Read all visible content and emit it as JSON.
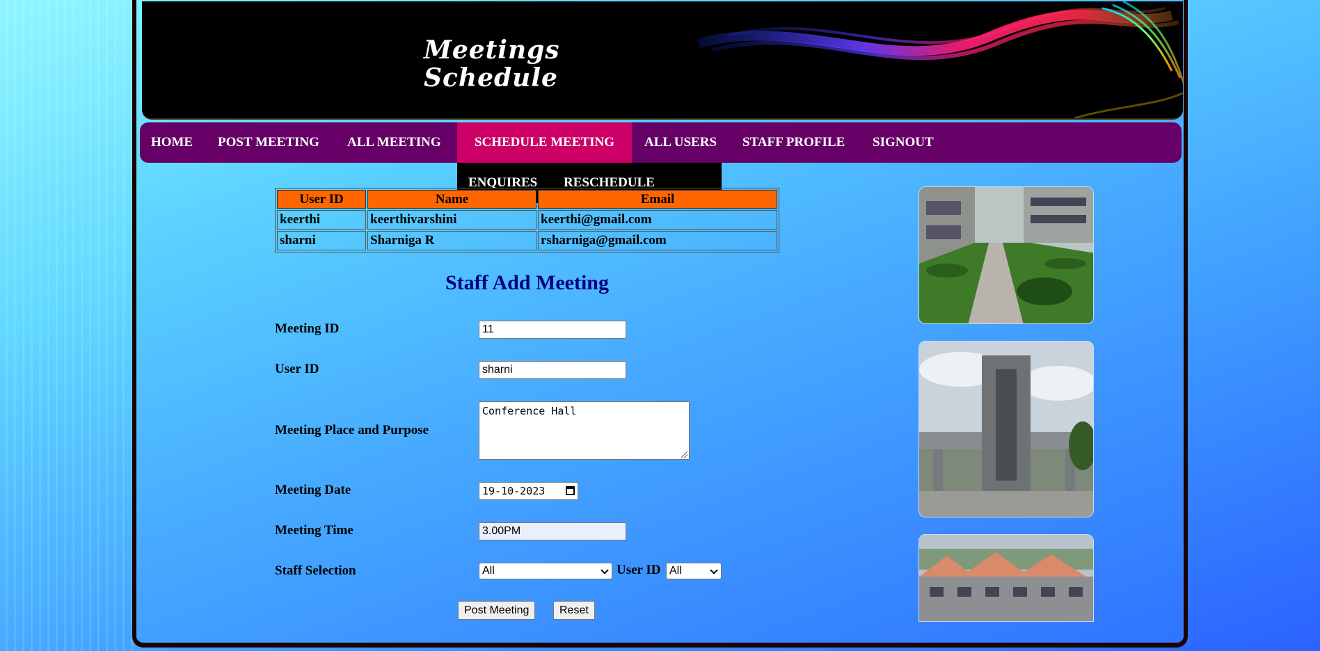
{
  "header": {
    "title_line1": "Meetings",
    "title_line2": "Schedule"
  },
  "nav": {
    "items": [
      "HOME",
      "POST MEETING",
      "ALL MEETING",
      "SCHEDULE MEETING",
      "ALL USERS",
      "STAFF PROFILE",
      "SIGNOUT"
    ],
    "active": "SCHEDULE MEETING",
    "dropdown": [
      "ENQUIRES",
      "RESCHEDULE"
    ]
  },
  "users_table": {
    "headers": [
      "User ID",
      "Name",
      "Email"
    ],
    "rows": [
      [
        "keerthi",
        "keerthivarshini",
        "keerthi@gmail.com"
      ],
      [
        "sharni",
        "Sharniga R",
        "rsharniga@gmail.com"
      ]
    ]
  },
  "form": {
    "title": "Staff Add Meeting",
    "meeting_id_label": "Meeting ID",
    "meeting_id_value": "11",
    "user_id_label": "User ID",
    "user_id_value": "sharni",
    "place_label": "Meeting Place and Purpose",
    "place_value": "Conference Hall",
    "date_label": "Meeting Date",
    "date_value": "19-10-2023",
    "time_label": "Meeting Time",
    "time_value": "3.00PM",
    "staff_label": "Staff Selection",
    "staff_selected": "All",
    "user_id_select_label": "User ID",
    "user_id_selected": "All",
    "post_button": "Post Meeting",
    "reset_button": "Reset"
  },
  "icons": {
    "calendar": "calendar-icon",
    "dropdown": "chevron-down-icon"
  },
  "colors": {
    "nav_bg": "#660066",
    "nav_active": "#cc0066",
    "table_header": "#ff6600",
    "form_title": "#000080",
    "dropdown_bg": "#000000"
  }
}
